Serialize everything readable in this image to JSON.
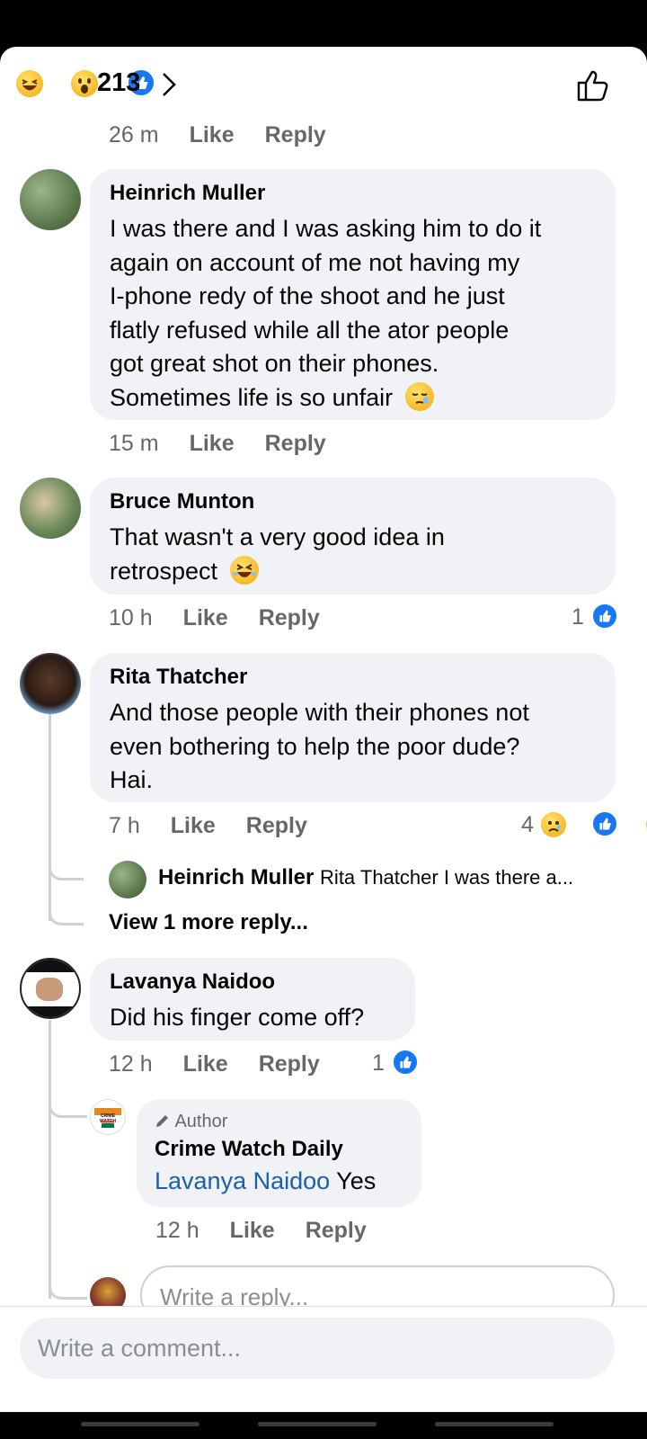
{
  "header": {
    "reaction_count": "213",
    "reaction_icons": [
      "laughing-emoji-icon",
      "wow-emoji-icon",
      "like-icon"
    ],
    "like_icon": "thumbs-up-outline-icon"
  },
  "labels": {
    "like": "Like",
    "reply": "Reply",
    "author_badge": "Author"
  },
  "comments": [
    {
      "meta_time": "26 m"
    },
    {
      "author": "Heinrich Muller",
      "lines": [
        "I was there and I was asking him to do it",
        "again on account of me not having my",
        "I-phone redy of the shoot and he just",
        "flatly refused while all the ator people",
        "got great shot on their phones.",
        "Sometimes life is so unfair"
      ],
      "time": "15 m"
    },
    {
      "author": "Bruce Munton",
      "lines": [
        "That wasn't a very good idea in",
        "retrospect"
      ],
      "time": "10 h",
      "reactions": "1"
    },
    {
      "author": "Rita Thatcher",
      "lines": [
        "And those people with their phones not",
        "even bothering to help the poor dude?",
        "Hai."
      ],
      "time": "7 h",
      "reactions": "4",
      "reply_preview": {
        "author": "Heinrich Muller",
        "text": "Rita Thatcher I was there a..."
      },
      "view_more": "View 1 more reply..."
    },
    {
      "author": "Lavanya Naidoo",
      "lines": [
        "Did his finger come off?"
      ],
      "time": "12 h",
      "reactions": "1",
      "reply": {
        "badge_author": "Crime Watch Daily",
        "mention": "Lavanya Naidoo",
        "text": "Yes",
        "time": "12 h",
        "logo_text": "CRIME WATCH"
      }
    }
  ],
  "reply_input": {
    "placeholder": "Write a reply..."
  },
  "comment_input": {
    "placeholder": "Write a comment..."
  },
  "colors": {
    "brand_blue": "#1877f2",
    "bubble": "#f0f2f5",
    "meta": "#65676b"
  }
}
